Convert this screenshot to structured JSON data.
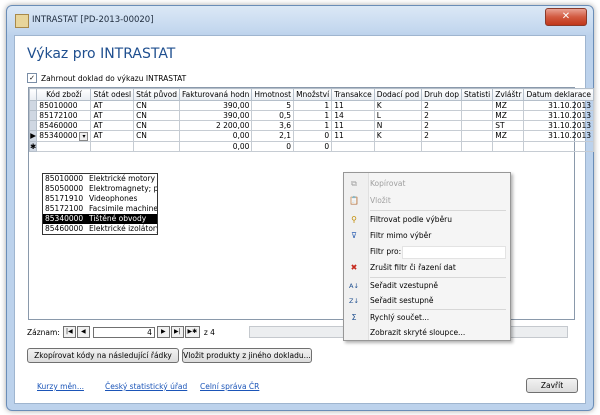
{
  "window": {
    "title": "INTRASTAT [PD-2013-00020]",
    "close_glyph": "✕"
  },
  "page": {
    "heading": "Výkaz pro INTRASTAT"
  },
  "checkbox": {
    "label": "Zahrnout doklad do výkazu INTRASTAT",
    "checked": true,
    "mark": "✓"
  },
  "grid": {
    "columns": [
      "Kód zboží",
      "Stát odesl",
      "Stát původ",
      "Fakturovaná hodn",
      "Hmotnost",
      "Množství",
      "Transakce",
      "Dodací pod",
      "Druh dop",
      "Statisti",
      "Zvláštr",
      "Datum deklarace"
    ],
    "rows": [
      [
        "85010000",
        "AT",
        "CN",
        "390,00",
        "5",
        "1",
        "11",
        "K",
        "2",
        "",
        "MZ",
        "31.10.2013"
      ],
      [
        "85172100",
        "AT",
        "CN",
        "390,00",
        "0,5",
        "1",
        "14",
        "L",
        "2",
        "",
        "MZ",
        "31.10.2013"
      ],
      [
        "85460000",
        "AT",
        "CN",
        "2 200,00",
        "3,6",
        "1",
        "11",
        "N",
        "2",
        "",
        "ST",
        "31.10.2013"
      ],
      [
        "85340000",
        "AT",
        "CN",
        "0,00",
        "2,1",
        "0",
        "11",
        "K",
        "2",
        "",
        "MZ",
        "31.10.2013"
      ],
      [
        "",
        "",
        "",
        "0,00",
        "0",
        "0",
        "",
        "",
        "",
        "",
        "",
        ""
      ]
    ],
    "current_marker": "▶",
    "new_marker": "✱",
    "combo_arrow": "▾"
  },
  "dropdown": {
    "items": [
      {
        "code": "85010000",
        "desc": "Elektrické motory a ge"
      },
      {
        "code": "85050000",
        "desc": "Elektromagnety; perm"
      },
      {
        "code": "85171910",
        "desc": "Videophones"
      },
      {
        "code": "85172100",
        "desc": "Facsimile machines"
      },
      {
        "code": "85340000",
        "desc": "Tištěné obvody"
      },
      {
        "code": "85460000",
        "desc": "Elektrické izolátory z"
      }
    ],
    "selected_index": 4
  },
  "navigator": {
    "label": "Záznam:",
    "first": "|◀",
    "prev": "◀",
    "current": "4",
    "next": "▶",
    "last": "▶|",
    "new": "▶✱",
    "total_text": "z 4"
  },
  "buttons": {
    "copy_codes": "Zkopírovat kódy na následující řádky",
    "insert_products": "Vložit produkty z jiného dokladu...",
    "close": "Zavřít"
  },
  "links": {
    "rates": "Kurzy měn...",
    "stat_office": "Český statistický úřad",
    "customs": "Celní správa ČR"
  },
  "context_menu": {
    "copy": "Kopírovat",
    "paste": "Vložit",
    "filter_by_selection": "Filtrovat podle výběru",
    "filter_excluding": "Filtr mimo výběr",
    "filter_for": "Filtr pro:",
    "remove_filter": "Zrušit filtr či řazení dat",
    "sort_asc": "Seřadit vzestupně",
    "sort_desc": "Seřadit sestupně",
    "quick_sum": "Rychlý součet...",
    "show_hidden": "Zobrazit skryté sloupce...",
    "icons": {
      "copy": "⧉",
      "paste": "📋",
      "filter_sel": "⚲",
      "filter_ex": "⊽",
      "remove": "✖",
      "asc": "A↓",
      "desc": "Z↓",
      "sum": "Σ"
    }
  }
}
